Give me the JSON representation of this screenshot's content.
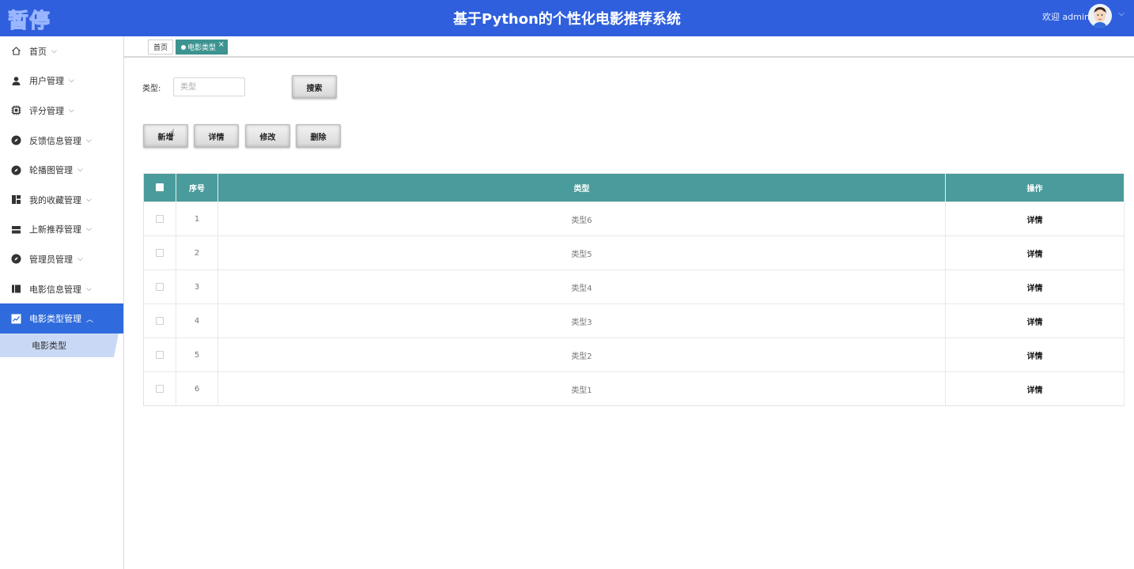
{
  "header": {
    "logo": "暂停",
    "title": "基于Python的个性化电影推荐系统",
    "welcome": "欢迎 admin"
  },
  "sidebar": {
    "items": [
      {
        "label": "首页",
        "icon": "home-icon"
      },
      {
        "label": "用户管理",
        "icon": "user-icon"
      },
      {
        "label": "评分管理",
        "icon": "chip-icon"
      },
      {
        "label": "反馈信息管理",
        "icon": "compass-icon"
      },
      {
        "label": "轮播图管理",
        "icon": "compass-icon"
      },
      {
        "label": "我的收藏管理",
        "icon": "dashboard-icon"
      },
      {
        "label": "上新推荐管理",
        "icon": "list-icon"
      },
      {
        "label": "管理员管理",
        "icon": "compass-icon"
      },
      {
        "label": "电影信息管理",
        "icon": "columns-icon"
      },
      {
        "label": "电影类型管理",
        "icon": "chart-icon"
      }
    ],
    "submenu": {
      "label": "电影类型"
    }
  },
  "tabs": {
    "home": "首页",
    "active": "电影类型"
  },
  "search": {
    "label": "类型:",
    "placeholder": "类型",
    "button": "搜索"
  },
  "actions": {
    "add": "新增",
    "detail": "详情",
    "edit": "修改",
    "delete": "删除"
  },
  "table": {
    "headers": {
      "index": "序号",
      "type": "类型",
      "action": "操作"
    },
    "rows": [
      {
        "index": "1",
        "type": "类型6",
        "action": "详情"
      },
      {
        "index": "2",
        "type": "类型5",
        "action": "详情"
      },
      {
        "index": "3",
        "type": "类型4",
        "action": "详情"
      },
      {
        "index": "4",
        "type": "类型3",
        "action": "详情"
      },
      {
        "index": "5",
        "type": "类型2",
        "action": "详情"
      },
      {
        "index": "6",
        "type": "类型1",
        "action": "详情"
      }
    ]
  },
  "colors": {
    "header": "#2f5fdc",
    "active_menu": "#2f6bdc",
    "submenu": "#c9d9f5",
    "table_header": "#4a9b9b",
    "tab_active": "#3d9390"
  }
}
